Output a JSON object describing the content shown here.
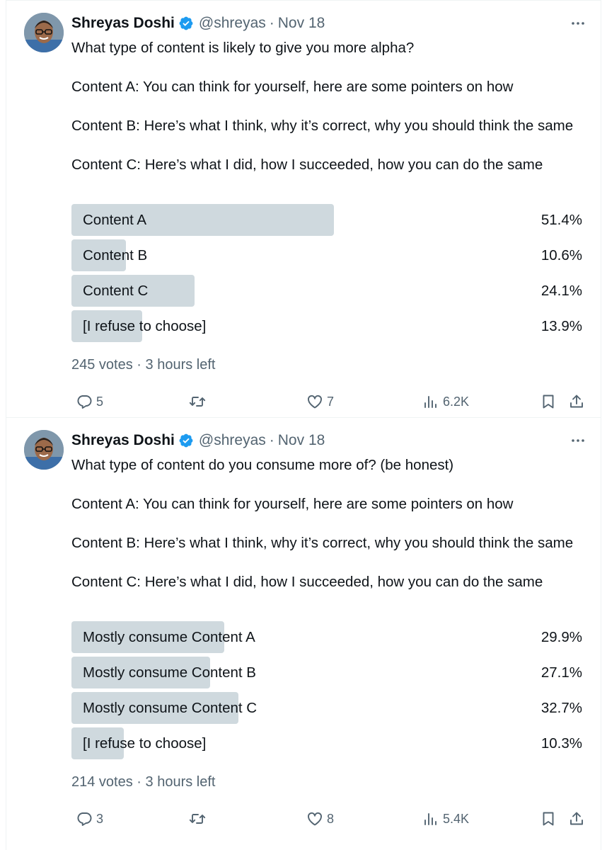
{
  "tweets": [
    {
      "author": {
        "name": "Shreyas Doshi",
        "handle": "@shreyas",
        "separator": "·",
        "date": "Nov 18"
      },
      "text": {
        "question": "What type of content is likely to give you more alpha?",
        "line_a": "Content A: You can think for yourself, here are some pointers on how",
        "line_b": "Content B: Here’s what I think, why it’s correct, why you should think the same",
        "line_c": "Content C: Here’s what I did, how I succeeded, how you can do the same"
      },
      "poll": {
        "options": [
          {
            "label": "Content A",
            "percent": "51.4%",
            "share": 51.4
          },
          {
            "label": "Content B",
            "percent": "10.6%",
            "share": 10.6
          },
          {
            "label": "Content C",
            "percent": "24.1%",
            "share": 24.1
          },
          {
            "label": "[I refuse to choose]",
            "percent": "13.9%",
            "share": 13.9
          }
        ],
        "votes": "245 votes",
        "separator": "·",
        "time_left": "3 hours left"
      },
      "stats": {
        "replies": "5",
        "retweets": "",
        "likes": "7",
        "views": "6.2K"
      }
    },
    {
      "author": {
        "name": "Shreyas Doshi",
        "handle": "@shreyas",
        "separator": "·",
        "date": "Nov 18"
      },
      "text": {
        "question": "What type of content do you consume more of? (be honest)",
        "line_a": "Content A: You can think for yourself, here are some pointers on how",
        "line_b": "Content B: Here’s what I think, why it’s correct, why you should think the same",
        "line_c": "Content C: Here’s what I did, how I succeeded, how you can do the same"
      },
      "poll": {
        "options": [
          {
            "label": "Mostly consume Content A",
            "percent": "29.9%",
            "share": 29.9
          },
          {
            "label": "Mostly consume Content B",
            "percent": "27.1%",
            "share": 27.1
          },
          {
            "label": "Mostly consume Content C",
            "percent": "32.7%",
            "share": 32.7
          },
          {
            "label": "[I refuse to choose]",
            "percent": "10.3%",
            "share": 10.3
          }
        ],
        "votes": "214 votes",
        "separator": "·",
        "time_left": "3 hours left"
      },
      "stats": {
        "replies": "3",
        "retweets": "",
        "likes": "8",
        "views": "5.4K"
      }
    }
  ],
  "colors": {
    "text": "#0f1419",
    "secondary": "#536471",
    "poll_fill": "#cfd9de",
    "verified": "#1d9bf0",
    "divider": "#eff3f4"
  },
  "icons": [
    "reply-icon",
    "retweet-icon",
    "like-icon",
    "views-icon",
    "bookmark-icon",
    "share-icon",
    "more-icon",
    "verified-badge-icon"
  ]
}
